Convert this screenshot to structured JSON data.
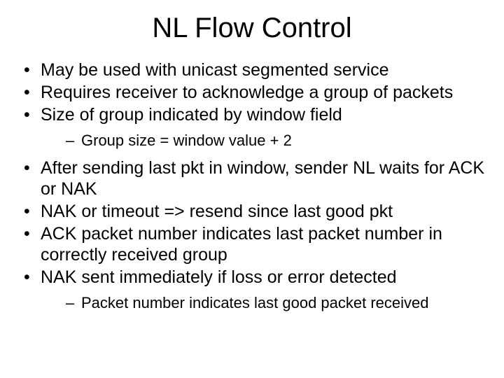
{
  "title": "NL Flow Control",
  "bullets": [
    {
      "text": "May be used with unicast segmented service"
    },
    {
      "text": "Requires receiver to acknowledge a group of packets"
    },
    {
      "text": "Size of group indicated by window field",
      "sub": [
        "Group size = window value + 2"
      ]
    },
    {
      "text": "After sending last pkt in window, sender NL waits for ACK or NAK"
    },
    {
      "text": "NAK or timeout => resend since last good pkt"
    },
    {
      "text": "ACK packet number indicates last packet number in correctly received group"
    },
    {
      "text": "NAK sent immediately if loss or error detected",
      "sub": [
        "Packet number indicates last good packet received"
      ]
    }
  ]
}
